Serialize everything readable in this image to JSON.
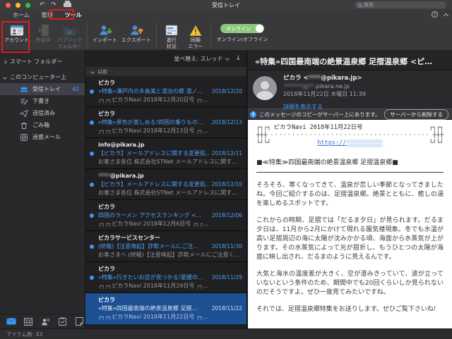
{
  "window": {
    "title": "受信トレイ"
  },
  "titlebar": {
    "search_placeholder": "検索"
  },
  "ribbon": {
    "tabs": [
      {
        "label": "ホーム"
      },
      {
        "label": "整理"
      },
      {
        "label": "ツール"
      }
    ],
    "buttons": {
      "account": {
        "label": "アカウント"
      },
      "out_of_office": {
        "label": "外出中"
      },
      "public_folders": {
        "label": "パブリック",
        "label2": "フォルダー"
      },
      "import": {
        "label": "インポート"
      },
      "export": {
        "label": "エクスポート"
      },
      "progress": {
        "label": "進行",
        "label2": "状況"
      },
      "sync_errors": {
        "label": "同期",
        "label2": "エラー"
      },
      "online_toggle": {
        "state": "オンライン",
        "label": "オンライン/オフライン"
      }
    }
  },
  "sidebar": {
    "smart_folders": "スマート フォルダー",
    "on_this_computer": "このコンピューター上",
    "folders": [
      {
        "label": "受信トレイ",
        "count": "42"
      },
      {
        "label": "下書き"
      },
      {
        "label": "送信済み"
      },
      {
        "label": "ごみ箱"
      },
      {
        "label": "迷惑メール"
      }
    ]
  },
  "list": {
    "sort_label": "並べ替え: スレッド",
    "sort_direction": "↓",
    "group_label": "以前",
    "items": [
      {
        "sender": "ピカラ",
        "subject": "«特集»瀬戸内の多島美と湯治の郷 湯ノ…",
        "date": "2018/12/20",
        "preview": "┌┐┌┐ピカラNavi 2018年12月20日号 ┌┐…"
      },
      {
        "sender": "ピカラ",
        "subject": "«特集»景色が楽しめる!四国の乗りもの…",
        "date": "2018/12/13",
        "preview": "┌┐┌┐ピカラNavi 2018年12月13日号 ┌┐…"
      },
      {
        "sender": "info@pikara.jp",
        "subject": "【ピカラ】メールアドレスに関する変更処…",
        "date": "2018/12/11",
        "preview": "お客さま各位 株式会社STNet メールアドレスに関す…"
      },
      {
        "sender_masked": "****",
        "sender_domain": "@pikara.jp",
        "subject": "【ピカラ】メールアドレスに関する変更処…",
        "date": "2018/12/10",
        "preview": "お客さま各位 株式会社STNet メールアドレスに関す…"
      },
      {
        "sender": "ピカラ",
        "subject": "四国のラーメン アクセスランキング <…",
        "date": "2018/12/06",
        "preview": "┌┐┌┐ピカラNavi 2018年12月6日号 ┌┐┌…"
      },
      {
        "sender": "ピカラサービスセンター",
        "subject": "(続報)【注意喚起】詐欺メールにご注…",
        "date": "2018/11/30",
        "preview": "お客さまへ (続報)【注意喚起】詐欺メールにご注意く…"
      },
      {
        "sender": "ピカラ",
        "subject": "«特集»行きたいお店が見つかる!愛媛の…",
        "date": "2018/11/29",
        "preview": "┌┐┌┐ピカラNavi 2018年11月29日号 ┌┐…"
      },
      {
        "sender": "ピカラ",
        "subject": "«特集»四国最南端の絶景温泉郷 足摺…",
        "date": "2018/11/22",
        "preview": "┌┐┌┐ピカラNavi 2018年11月22日号 ┌┐…"
      }
    ]
  },
  "reading": {
    "subject": "«特集»四国最南端の絶景温泉郷 足摺温泉郷 <ピ…",
    "from_prefix": "ピカラ <",
    "from_masked": "****",
    "from_suffix": "@pikara.jp>",
    "to_masked": "*******@**",
    "to_domain": ".pikara.ne.jp",
    "date_line": "2018年11月22日 木曜日 11:39",
    "details_link": "詳細を表示する",
    "server_notice": "このメッセージのコピーがサーバー上にあります。",
    "server_button": "サーバーから削除する",
    "body": {
      "banner_left_top": "┌┐┌┐",
      "banner_title": "ピカラNavi 2018年11月22日号",
      "banner_right_top": "┌┐┌┐",
      "banner_left_mid": "┼┼┼",
      "banner_dots": "················································",
      "banner_right_mid": "┼┼┼",
      "banner_left_bot": "└┘└┘",
      "banner_link_prefix": "https://",
      "banner_link_masked": "**********",
      "banner_right_bot": "└┘└┘",
      "section_title": "■≪特集≫四国最南端の絶景温泉郷 足摺温泉郷■",
      "paragraphs": [
        "そろそろ、寒くなってきて、温泉が恋しい季節となってきましたね。今回ご紹介するのは、足摺温泉郷。絶景とともに、癒しの湯を楽しめるスポットです。",
        "これからの時期、足摺では「だるま夕日」が見られます。だるま夕日は、11月から2月にかけて現れる蜃気楼現象。冬でも水温が高い足摺周辺の海に太陽が沈みかかる頃、海面から水蒸気が上がります。その水蒸気によって光が屈折し、もうひとつの太陽が海面に映し出され、だるまのように見えるんです。",
        "大気と海水の温度差が大きく、空が澄みきっていて、波が立っていないという条件のため、期間中でも20回くらいしか見られないのだそうですよ。ぜひ一度見てみたいですね。",
        "それでは、足摺温泉郷特集をお送りします。ぜひご覧下さいね!"
      ]
    }
  },
  "status_bar": {
    "item_count": "アイテム数: 43"
  },
  "annotations": {
    "highlight_color": "#e01b1b"
  },
  "colors": {
    "link_blue": "#3b99fc",
    "unread_blue": "#4ba0f5",
    "selection_blue": "#1d4f93",
    "online_green": "#8dc87e"
  }
}
